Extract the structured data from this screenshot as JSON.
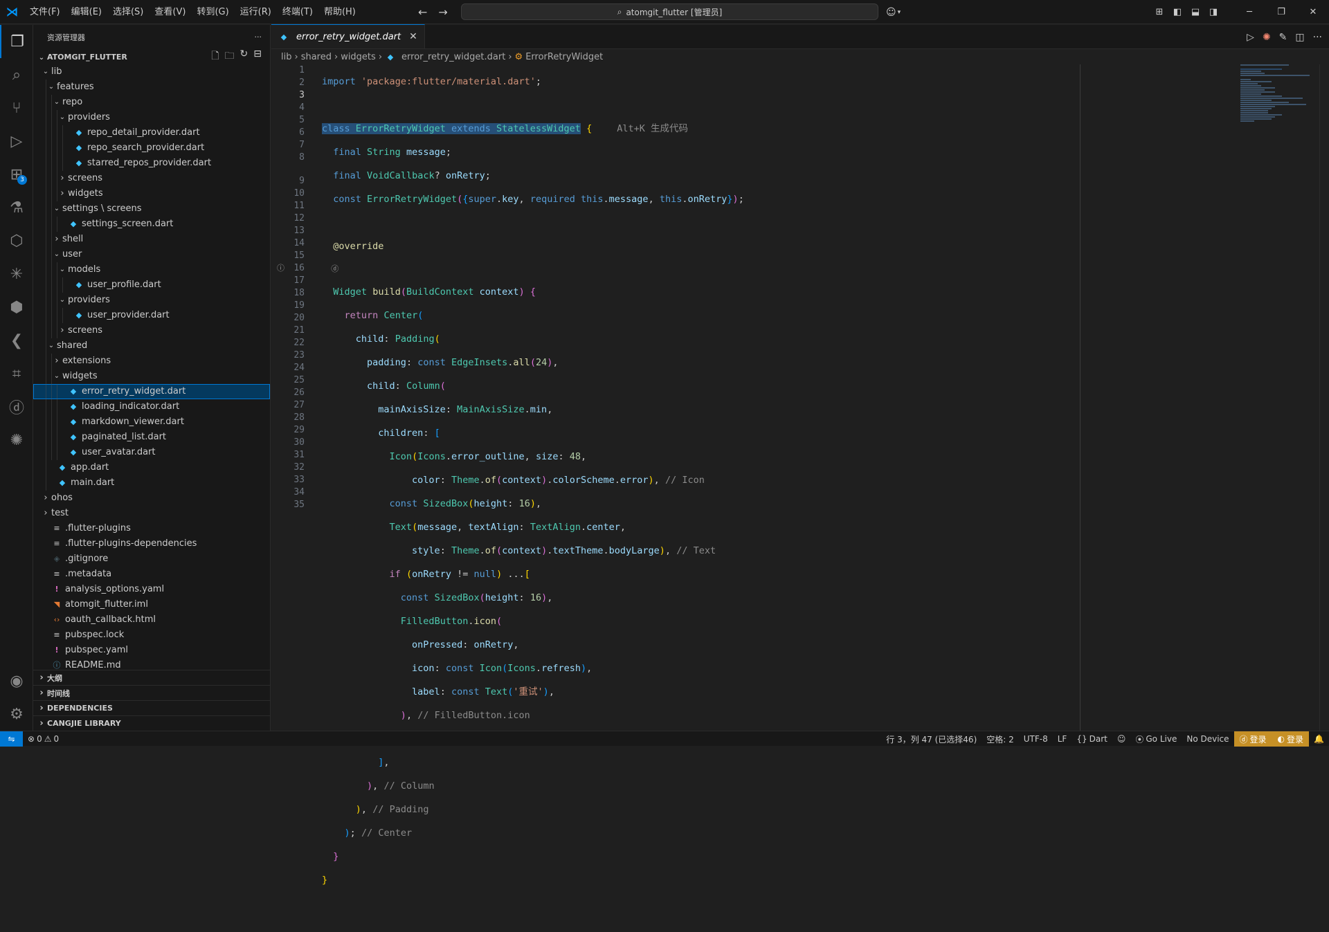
{
  "titlebar": {
    "menus": [
      "文件(F)",
      "编辑(E)",
      "选择(S)",
      "查看(V)",
      "转到(G)",
      "运行(R)",
      "终端(T)",
      "帮助(H)"
    ],
    "search_text": "atomgit_flutter [管理员]"
  },
  "activity_bar": {
    "extensions_badge": "3"
  },
  "sidebar": {
    "header": "资源管理器",
    "project": "ATOMGIT_FLUTTER",
    "tree": [
      {
        "label": "lib",
        "depth": 0,
        "kind": "folder-open"
      },
      {
        "label": "features",
        "depth": 1,
        "kind": "folder-open"
      },
      {
        "label": "repo",
        "depth": 2,
        "kind": "folder-open"
      },
      {
        "label": "providers",
        "depth": 3,
        "kind": "folder-open"
      },
      {
        "label": "repo_detail_provider.dart",
        "depth": 4,
        "kind": "dart"
      },
      {
        "label": "repo_search_provider.dart",
        "depth": 4,
        "kind": "dart"
      },
      {
        "label": "starred_repos_provider.dart",
        "depth": 4,
        "kind": "dart"
      },
      {
        "label": "screens",
        "depth": 3,
        "kind": "folder"
      },
      {
        "label": "widgets",
        "depth": 3,
        "kind": "folder"
      },
      {
        "label": "settings \\ screens",
        "depth": 2,
        "kind": "folder-open"
      },
      {
        "label": "settings_screen.dart",
        "depth": 3,
        "kind": "dart"
      },
      {
        "label": "shell",
        "depth": 2,
        "kind": "folder"
      },
      {
        "label": "user",
        "depth": 2,
        "kind": "folder-open"
      },
      {
        "label": "models",
        "depth": 3,
        "kind": "folder-open"
      },
      {
        "label": "user_profile.dart",
        "depth": 4,
        "kind": "dart"
      },
      {
        "label": "providers",
        "depth": 3,
        "kind": "folder-open"
      },
      {
        "label": "user_provider.dart",
        "depth": 4,
        "kind": "dart"
      },
      {
        "label": "screens",
        "depth": 3,
        "kind": "folder"
      },
      {
        "label": "shared",
        "depth": 1,
        "kind": "folder-open"
      },
      {
        "label": "extensions",
        "depth": 2,
        "kind": "folder"
      },
      {
        "label": "widgets",
        "depth": 2,
        "kind": "folder-open"
      },
      {
        "label": "error_retry_widget.dart",
        "depth": 3,
        "kind": "dart",
        "selected": true
      },
      {
        "label": "loading_indicator.dart",
        "depth": 3,
        "kind": "dart"
      },
      {
        "label": "markdown_viewer.dart",
        "depth": 3,
        "kind": "dart"
      },
      {
        "label": "paginated_list.dart",
        "depth": 3,
        "kind": "dart"
      },
      {
        "label": "user_avatar.dart",
        "depth": 3,
        "kind": "dart"
      },
      {
        "label": "app.dart",
        "depth": 1,
        "kind": "dart"
      },
      {
        "label": "main.dart",
        "depth": 1,
        "kind": "dart"
      },
      {
        "label": "ohos",
        "depth": 0,
        "kind": "folder"
      },
      {
        "label": "test",
        "depth": 0,
        "kind": "folder"
      },
      {
        "label": ".flutter-plugins",
        "depth": 0,
        "kind": "lines"
      },
      {
        "label": ".flutter-plugins-dependencies",
        "depth": 0,
        "kind": "lines"
      },
      {
        "label": ".gitignore",
        "depth": 0,
        "kind": "git"
      },
      {
        "label": ".metadata",
        "depth": 0,
        "kind": "lines"
      },
      {
        "label": "analysis_options.yaml",
        "depth": 0,
        "kind": "excl"
      },
      {
        "label": "atomgit_flutter.iml",
        "depth": 0,
        "kind": "rss"
      },
      {
        "label": "oauth_callback.html",
        "depth": 0,
        "kind": "html"
      },
      {
        "label": "pubspec.lock",
        "depth": 0,
        "kind": "lines"
      },
      {
        "label": "pubspec.yaml",
        "depth": 0,
        "kind": "excl"
      },
      {
        "label": "README.md",
        "depth": 0,
        "kind": "info"
      }
    ],
    "panels": [
      "大纲",
      "时间线",
      "DEPENDENCIES",
      "CANGJIE LIBRARY"
    ]
  },
  "editor": {
    "tab_label": "error_retry_widget.dart",
    "breadcrumbs": [
      "lib",
      "shared",
      "widgets",
      "error_retry_widget.dart",
      "ErrorRetryWidget"
    ],
    "hint": "Alt+K 生成代码",
    "current_line": 3
  },
  "statusbar": {
    "errors": "0",
    "warnings": "0",
    "position": "行 3，列 47 (已选择46)",
    "spaces": "空格: 2",
    "encoding": "UTF-8",
    "eol": "LF",
    "language": "Dart",
    "golive": "Go Live",
    "device": "No Device",
    "login1": "登录",
    "login2": "登录"
  }
}
